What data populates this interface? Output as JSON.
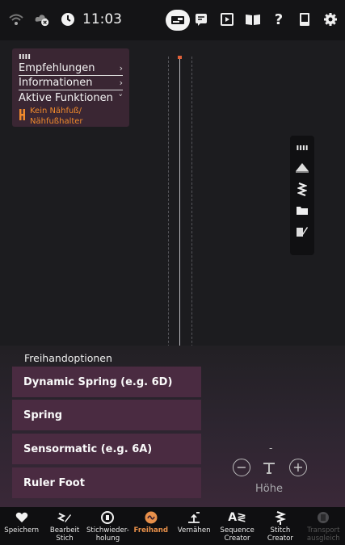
{
  "status_bar": {
    "time": "11:03",
    "icons": [
      "wifi-icon",
      "cloud-error-icon",
      "clock-icon",
      "machine-icon",
      "embroidery-icon",
      "tutorial-icon",
      "book-icon",
      "help-icon",
      "manual-icon",
      "settings-icon"
    ]
  },
  "info_panel": {
    "items": [
      {
        "label": "Empfehlungen",
        "chevron": "›"
      },
      {
        "label": "Informationen",
        "chevron": "›"
      },
      {
        "label": "Aktive Funktionen",
        "chevron": "˅"
      }
    ],
    "active_function": "Kein Nähfuß/\nNähfußhalter"
  },
  "right_toolbar": {
    "icons": [
      "grip-icon",
      "sewing-foot-icon",
      "stitch-icon",
      "folder-icon",
      "edit-icon"
    ]
  },
  "freehand": {
    "title": "Freihandoptionen",
    "options": [
      "Dynamic Spring (e.g. 6D)",
      "Spring",
      "Sensormatic (e.g. 6A)",
      "Ruler Foot"
    ],
    "height_value": "-",
    "height_label": "Höhe"
  },
  "bottom_nav": [
    {
      "label": "Speichern",
      "icon": "heart-icon"
    },
    {
      "label": "Bearbeit\nStich",
      "icon": "edit-stitch-icon"
    },
    {
      "label": "Stichwieder-\nholung",
      "icon": "repeat-icon"
    },
    {
      "label": "Freihand",
      "icon": "freehand-icon",
      "active": true
    },
    {
      "label": "Vernähen",
      "icon": "tie-off-icon"
    },
    {
      "label": "Sequence\nCreator",
      "icon": "sequence-icon"
    },
    {
      "label": "Stitch\nCreator",
      "icon": "stitch-creator-icon"
    },
    {
      "label": "Transport\nausgleich",
      "icon": "transport-icon",
      "disabled": true
    }
  ],
  "colors": {
    "accent": "#e8904a",
    "option_bg": "#4a2b41",
    "panel_bg": "#3a2633",
    "warning_text": "#f08a2c"
  }
}
